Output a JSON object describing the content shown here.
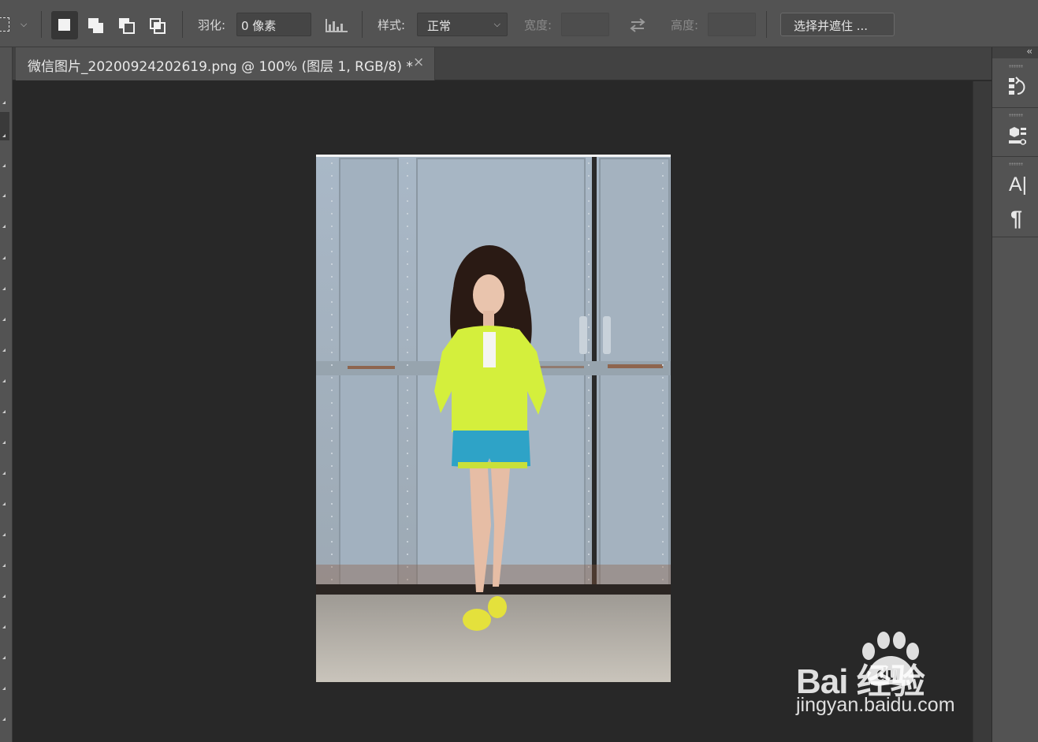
{
  "options_bar": {
    "feather_label": "羽化:",
    "feather_value": "0 像素",
    "style_label": "样式:",
    "style_value": "正常",
    "width_label": "宽度:",
    "height_label": "高度:",
    "select_mask_button": "选择并遮住 ..."
  },
  "document_tab": {
    "title": "微信图片_20200924202619.png @ 100% (图层 1, RGB/8) *",
    "close": "×"
  },
  "right_panel": {
    "collapse": "‹‹",
    "character_label": "A|",
    "paragraph_label": "¶"
  },
  "watermark": {
    "brand": "Bai   经验",
    "paw_text": "du",
    "url": "jingyan.baidu.com"
  },
  "colors": {
    "panel": "#535353",
    "canvas": "#282828",
    "jacket": "#d4ef3c",
    "shorts": "#2ea3c7"
  }
}
